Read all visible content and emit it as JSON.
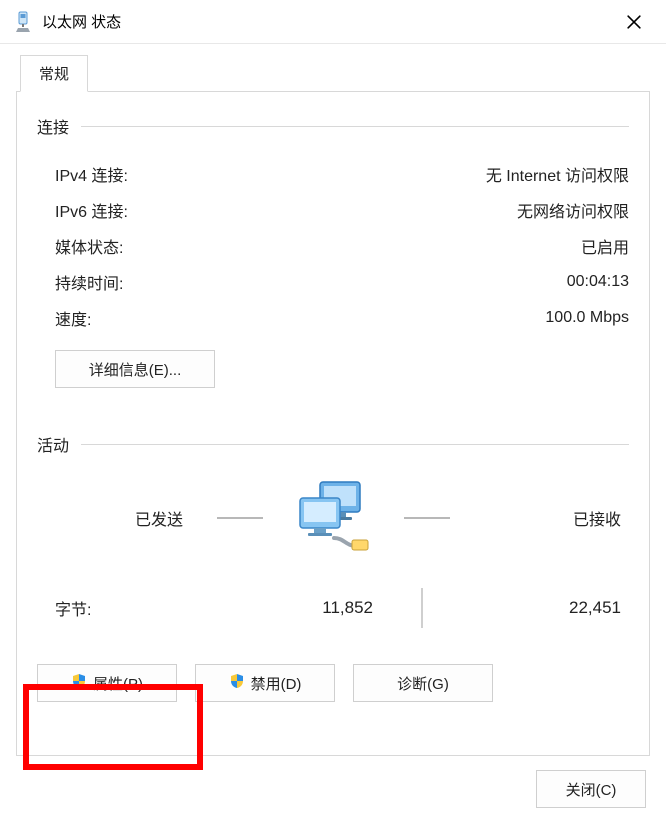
{
  "window": {
    "title": "以太网 状态"
  },
  "tab": {
    "label": "常规"
  },
  "connection": {
    "header": "连接",
    "rows": {
      "ipv4_label": "IPv4 连接:",
      "ipv4_value": "无 Internet 访问权限",
      "ipv6_label": "IPv6 连接:",
      "ipv6_value": "无网络访问权限",
      "media_label": "媒体状态:",
      "media_value": "已启用",
      "duration_label": "持续时间:",
      "duration_value": "00:04:13",
      "speed_label": "速度:",
      "speed_value": "100.0 Mbps"
    },
    "details_button": "详细信息(E)..."
  },
  "activity": {
    "header": "活动",
    "sent_label": "已发送",
    "received_label": "已接收",
    "bytes_label": "字节:",
    "bytes_sent": "11,852",
    "bytes_received": "22,451"
  },
  "buttons": {
    "properties": "属性(P)",
    "disable": "禁用(D)",
    "diagnose": "诊断(G)",
    "close": "关闭(C)"
  }
}
